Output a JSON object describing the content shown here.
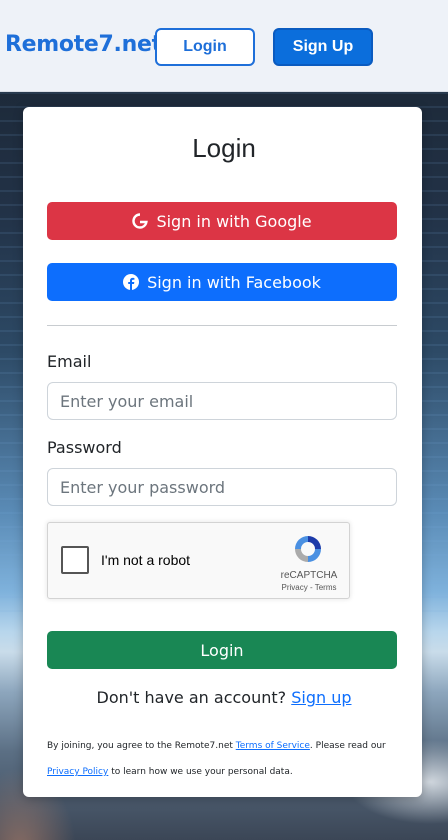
{
  "header": {
    "brand": "Remote7.net",
    "login_label": "Login",
    "signup_label": "Sign Up"
  },
  "card": {
    "title": "Login",
    "google_label": "Sign in with Google",
    "facebook_label": "Sign in with Facebook",
    "email_label": "Email",
    "email_placeholder": "Enter your email",
    "password_label": "Password",
    "password_placeholder": "Enter your password",
    "submit_label": "Login",
    "signup_prompt": "Don't have an account?",
    "signup_link": "Sign up"
  },
  "recaptcha": {
    "label": "I'm not a robot",
    "brand": "reCAPTCHA",
    "privacy": "Privacy",
    "separator": " - ",
    "terms": "Terms"
  },
  "legal": {
    "prefix": "By joining, you agree to the Remote7.net ",
    "terms_link": "Terms of Service",
    "middle": ". Please read our ",
    "privacy_link": "Privacy Policy",
    "suffix": " to learn how we use your personal data."
  },
  "icons": {
    "google": "google-icon",
    "facebook": "facebook-icon",
    "recaptcha": "recaptcha-logo-icon"
  },
  "colors": {
    "brand_blue": "#1e6fd9",
    "google_red": "#dc3545",
    "facebook_blue": "#0d6efd",
    "submit_green": "#198754"
  }
}
